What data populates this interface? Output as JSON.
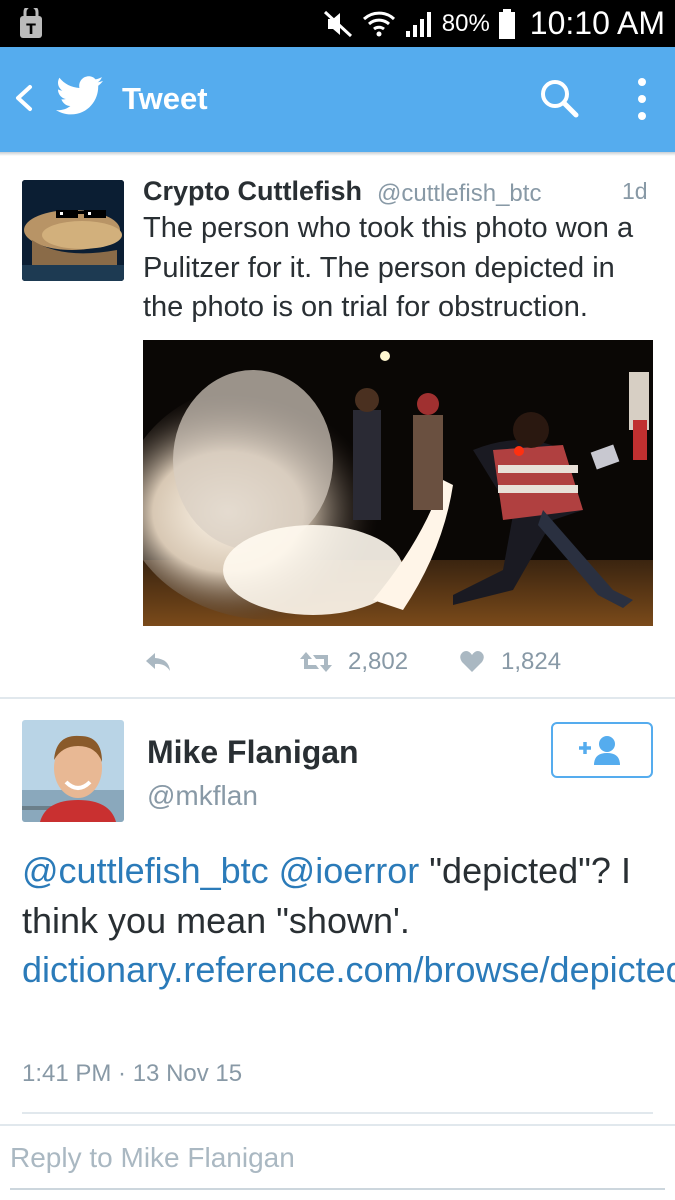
{
  "status_bar": {
    "battery": "80%",
    "time": "10:10 AM",
    "icons": [
      "carrier-icon",
      "mute-icon",
      "wifi-icon",
      "signal-icon",
      "battery-icon"
    ]
  },
  "app_bar": {
    "title": "Tweet",
    "color": "#55acee",
    "icons": [
      "back-arrow-icon",
      "twitter-bird-icon",
      "search-icon",
      "more-vert-icon"
    ]
  },
  "tweets": [
    {
      "name": "Crypto Cuttlefish",
      "handle": "@cuttlefish_btc",
      "time": "1d",
      "text": "The person who took this photo won a Pulitzer for it. The person depicted in the photo is on trial for obstruction.",
      "retweets": "2,802",
      "likes": "1,824"
    }
  ],
  "focused_tweet": {
    "name": "Mike Flanigan",
    "handle": "@mkflan",
    "mention1": "@cuttlefish_btc",
    "mention2": "@ioerror",
    "text": "\"depicted\"? I think you mean \"shown'.",
    "link": "dictionary.reference.com/browse/depicted",
    "meta": "1:41 PM · 13 Nov 15"
  },
  "reply": {
    "placeholder": "Reply to Mike Flanigan"
  },
  "colors": {
    "accent": "#55acee",
    "link": "#2b7bb9",
    "muted": "#8899a6"
  }
}
